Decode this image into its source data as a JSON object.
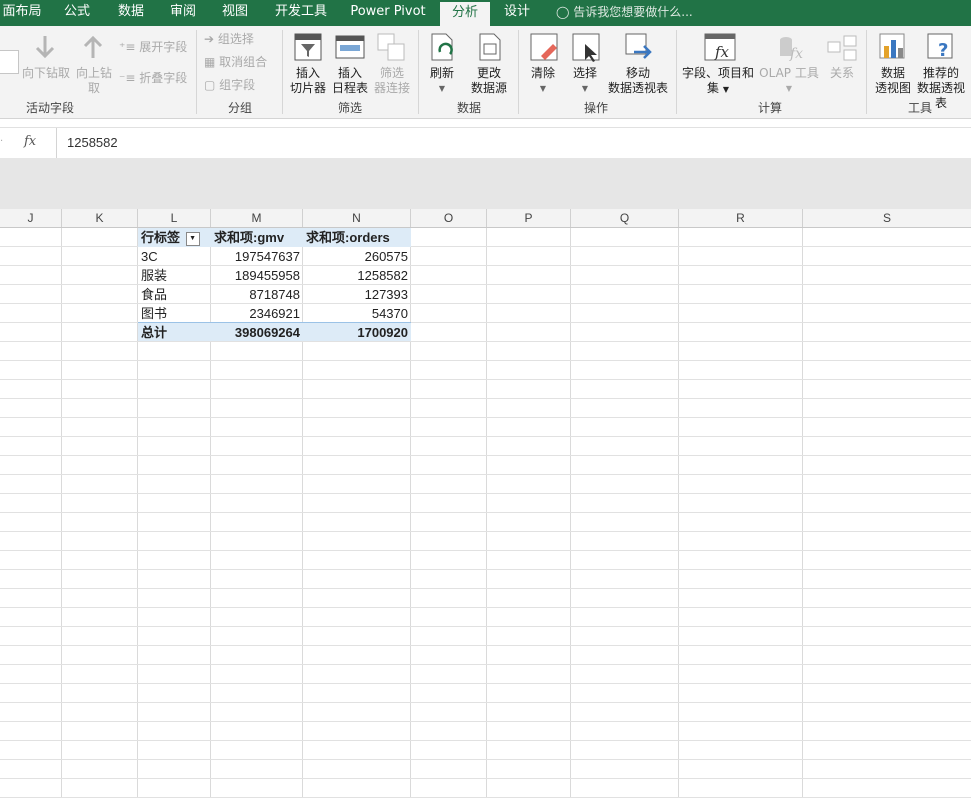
{
  "tabs": [
    {
      "label": "面布局",
      "active": false
    },
    {
      "label": "公式",
      "active": false
    },
    {
      "label": "数据",
      "active": false
    },
    {
      "label": "审阅",
      "active": false
    },
    {
      "label": "视图",
      "active": false
    },
    {
      "label": "开发工具",
      "active": false
    },
    {
      "label": "Power Pivot",
      "active": false
    },
    {
      "label": "分析",
      "active": true
    },
    {
      "label": "设计",
      "active": false
    }
  ],
  "tellme": "告诉我您想要做什么...",
  "ribbon": {
    "active_field": {
      "label": "活动字段",
      "drill_down": "向下钻取",
      "drill_up_1": "向上钻",
      "drill_up_2": "取",
      "expand": "展开字段",
      "collapse": "折叠字段"
    },
    "group": {
      "label": "分组",
      "group_selection": "组选择",
      "ungroup": "取消组合",
      "group_field": "组字段"
    },
    "filter": {
      "label": "筛选",
      "slicer_1": "插入",
      "slicer_2": "切片器",
      "timeline_1": "插入",
      "timeline_2": "日程表",
      "connections_1": "筛选",
      "connections_2": "器连接"
    },
    "data": {
      "label": "数据",
      "refresh": "刷新",
      "change_source_1": "更改",
      "change_source_2": "数据源"
    },
    "actions": {
      "label": "操作",
      "clear": "清除",
      "select": "选择",
      "move_1": "移动",
      "move_2": "数据透视表"
    },
    "calc": {
      "label": "计算",
      "fields_1": "字段、项目和",
      "fields_2": "集",
      "olap": "OLAP 工具",
      "relations": "关系"
    },
    "tools": {
      "label": "工具",
      "pivotchart_1": "数据",
      "pivotchart_2": "透视图",
      "recommended_1": "推荐的",
      "recommended_2": "数据透视表"
    }
  },
  "formula_bar": {
    "fx": "fx",
    "value": "1258582"
  },
  "columns": [
    "J",
    "K",
    "L",
    "M",
    "N",
    "O",
    "P",
    "Q",
    "R",
    "S"
  ],
  "pivot": {
    "headers": [
      "行标签",
      "求和项:gmv",
      "求和项:orders"
    ],
    "rows": [
      {
        "label": "3C",
        "gmv": "197547637",
        "orders": "260575"
      },
      {
        "label": "服装",
        "gmv": "189455958",
        "orders": "1258582"
      },
      {
        "label": "食品",
        "gmv": "8718748",
        "orders": "127393"
      },
      {
        "label": "图书",
        "gmv": "2346921",
        "orders": "54370"
      }
    ],
    "total": {
      "label": "总计",
      "gmv": "398069264",
      "orders": "1700920"
    }
  },
  "colors": {
    "accent": "#217346",
    "pivot_header": "#ddebf7"
  }
}
